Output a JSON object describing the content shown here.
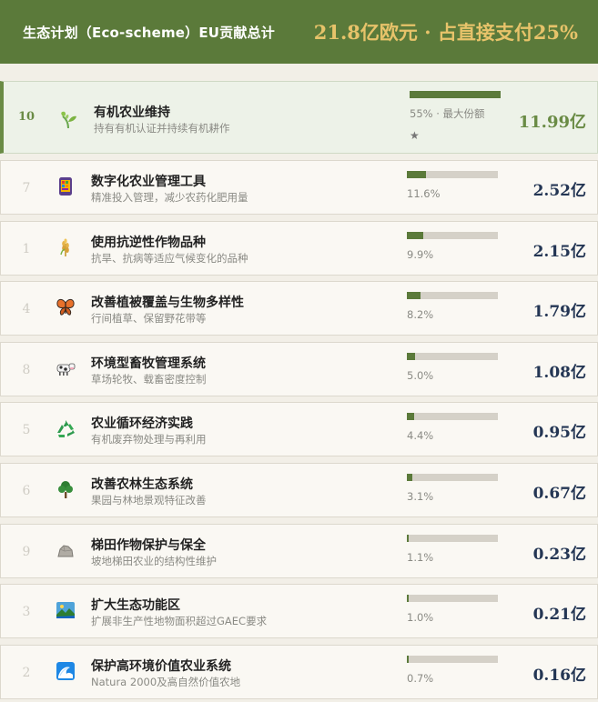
{
  "header": {
    "title": "生态计划（Eco-scheme）EU贡献总计",
    "total": "21.8亿欧元 · 占直接支付25%"
  },
  "items": [
    {
      "rank": "10",
      "icon": "sprout-icon",
      "name": "有机农业维持",
      "desc": "持有有机认证并持续有机耕作",
      "share": 0.55,
      "pct": "55% · 最大份额",
      "star": "★",
      "amount": "11.99亿"
    },
    {
      "rank": "7",
      "icon": "tablet-icon",
      "name": "数字化农业管理工具",
      "desc": "精准投入管理，减少农药化肥用量",
      "share": 0.116,
      "pct": "11.6%",
      "amount": "2.52亿"
    },
    {
      "rank": "1",
      "icon": "wheat-icon",
      "name": "使用抗逆性作物品种",
      "desc": "抗旱、抗病等适应气候变化的品种",
      "share": 0.099,
      "pct": "9.9%",
      "amount": "2.15亿"
    },
    {
      "rank": "4",
      "icon": "butterfly-icon",
      "name": "改善植被覆盖与生物多样性",
      "desc": "行间植草、保留野花带等",
      "share": 0.082,
      "pct": "8.2%",
      "amount": "1.79亿"
    },
    {
      "rank": "8",
      "icon": "cow-icon",
      "name": "环境型畜牧管理系统",
      "desc": "草场轮牧、载畜密度控制",
      "share": 0.05,
      "pct": "5.0%",
      "amount": "1.08亿"
    },
    {
      "rank": "5",
      "icon": "recycle-icon",
      "name": "农业循环经济实践",
      "desc": "有机废弃物处理与再利用",
      "share": 0.044,
      "pct": "4.4%",
      "amount": "0.95亿"
    },
    {
      "rank": "6",
      "icon": "tree-icon",
      "name": "改善农林生态系统",
      "desc": "果园与林地景观特征改善",
      "share": 0.031,
      "pct": "3.1%",
      "amount": "0.67亿"
    },
    {
      "rank": "9",
      "icon": "rock-icon",
      "name": "梯田作物保护与保全",
      "desc": "坡地梯田农业的结构性维护",
      "share": 0.011,
      "pct": "1.1%",
      "amount": "0.23亿"
    },
    {
      "rank": "3",
      "icon": "landscape-icon",
      "name": "扩大生态功能区",
      "desc": "扩展非生产性地物面积超过GAEC要求",
      "share": 0.01,
      "pct": "1.0%",
      "amount": "0.21亿"
    },
    {
      "rank": "2",
      "icon": "wave-icon",
      "name": "保护高环境价值农业系统",
      "desc": "Natura 2000及高自然价值农地",
      "share": 0.007,
      "pct": "0.7%",
      "amount": "0.16亿"
    }
  ]
}
